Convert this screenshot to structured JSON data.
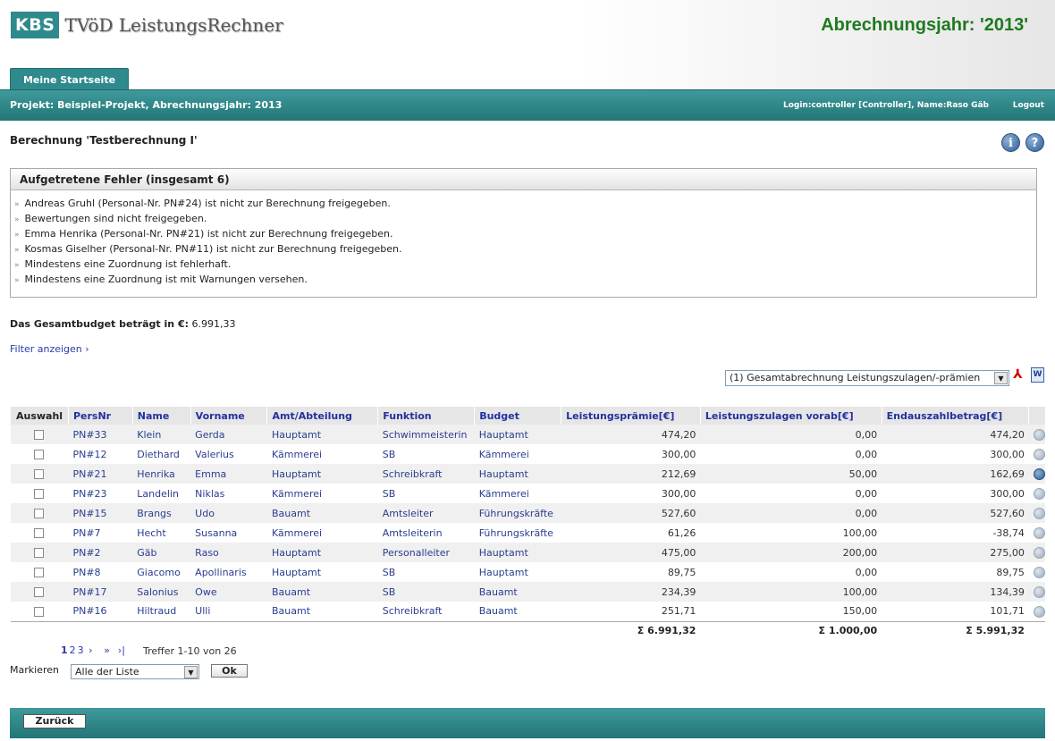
{
  "header": {
    "logo_box": "KBS",
    "logo_text": "TVöD LeistungsRechner",
    "year_title": "Abrechnungsjahr: '2013'"
  },
  "tabs": [
    {
      "label": "Meine Startseite"
    }
  ],
  "projectbar": {
    "project": "Projekt: Beispiel-Projekt, Abrechnungsjahr: 2013",
    "login": "Login:controller [Controller], Name:Raso Gäb",
    "logout": "Logout"
  },
  "calc_title": "Berechnung 'Testberechnung I'",
  "icons": {
    "info": "info-icon",
    "help": "help-icon"
  },
  "errors": {
    "title": "Aufgetretene Fehler (insgesamt 6)",
    "bullet": "»",
    "items": [
      "Andreas Gruhl (Personal-Nr. PN#24) ist nicht zur Berechnung freigegeben.",
      "Bewertungen sind nicht freigegeben.",
      "Emma Henrika (Personal-Nr. PN#21) ist nicht zur Berechnung freigegeben.",
      "Kosmas Giselher (Personal-Nr. PN#11) ist nicht zur Berechnung freigegeben.",
      "Mindestens eine Zuordnung ist fehlerhaft.",
      "Mindestens eine Zuordnung ist mit Warnungen versehen."
    ]
  },
  "budget": {
    "label": "Das Gesamtbudget beträgt in €:",
    "value": "6.991,33"
  },
  "filter_link": "Filter anzeigen ›",
  "report_select": {
    "value": "(1) Gesamtabrechnung Leistungszulagen/-prämien"
  },
  "table": {
    "headers": [
      "Auswahl",
      "PersNr",
      "Name",
      "Vorname",
      "Amt/Abteilung",
      "Funktion",
      "Budget",
      "Leistungsprämie[€]",
      "Leistungszulagen vorab[€]",
      "Endauszahlbetrag[€]"
    ],
    "rows": [
      {
        "persnr": "PN#33",
        "name": "Klein",
        "vorname": "Gerda",
        "amt": "Hauptamt",
        "funktion": "Schwimmeisterin",
        "budget": "Hauptamt",
        "praemie": "474,20",
        "vorab": "0,00",
        "end": "474,20"
      },
      {
        "persnr": "PN#12",
        "name": "Diethard",
        "vorname": "Valerius",
        "amt": "Kämmerei",
        "funktion": "SB",
        "budget": "Kämmerei",
        "praemie": "300,00",
        "vorab": "0,00",
        "end": "300,00"
      },
      {
        "persnr": "PN#21",
        "name": "Henrika",
        "vorname": "Emma",
        "amt": "Hauptamt",
        "funktion": "Schreibkraft",
        "budget": "Hauptamt",
        "praemie": "212,69",
        "vorab": "50,00",
        "end": "162,69"
      },
      {
        "persnr": "PN#23",
        "name": "Landelin",
        "vorname": "Niklas",
        "amt": "Kämmerei",
        "funktion": "SB",
        "budget": "Kämmerei",
        "praemie": "300,00",
        "vorab": "0,00",
        "end": "300,00"
      },
      {
        "persnr": "PN#15",
        "name": "Brangs",
        "vorname": "Udo",
        "amt": "Bauamt",
        "funktion": "Amtsleiter",
        "budget": "Führungskräfte",
        "praemie": "527,60",
        "vorab": "0,00",
        "end": "527,60"
      },
      {
        "persnr": "PN#7",
        "name": "Hecht",
        "vorname": "Susanna",
        "amt": "Kämmerei",
        "funktion": "Amtsleiterin",
        "budget": "Führungskräfte",
        "praemie": "61,26",
        "vorab": "100,00",
        "end": "-38,74"
      },
      {
        "persnr": "PN#2",
        "name": "Gäb",
        "vorname": "Raso",
        "amt": "Hauptamt",
        "funktion": "Personalleiter",
        "budget": "Hauptamt",
        "praemie": "475,00",
        "vorab": "200,00",
        "end": "275,00"
      },
      {
        "persnr": "PN#8",
        "name": "Giacomo",
        "vorname": "Apollinaris",
        "amt": "Hauptamt",
        "funktion": "SB",
        "budget": "Hauptamt",
        "praemie": "89,75",
        "vorab": "0,00",
        "end": "89,75"
      },
      {
        "persnr": "PN#17",
        "name": "Salonius",
        "vorname": "Owe",
        "amt": "Bauamt",
        "funktion": "SB",
        "budget": "Bauamt",
        "praemie": "234,39",
        "vorab": "100,00",
        "end": "134,39"
      },
      {
        "persnr": "PN#16",
        "name": "Hiltraud",
        "vorname": "Ulli",
        "amt": "Bauamt",
        "funktion": "Schreibkraft",
        "budget": "Bauamt",
        "praemie": "251,71",
        "vorab": "150,00",
        "end": "101,71"
      }
    ],
    "sums": {
      "praemie": "Σ 6.991,32",
      "vorab": "Σ 1.000,00",
      "end": "Σ 5.991,32"
    }
  },
  "pager": {
    "pages": [
      "1",
      "2",
      "3"
    ],
    "next": "›",
    "fast": "»",
    "last": "›|",
    "hits": "Treffer 1-10 von 26"
  },
  "mark": {
    "label": "Markieren",
    "value": "Alle der Liste",
    "ok": "Ok"
  },
  "footer": {
    "back": "Zurück"
  }
}
